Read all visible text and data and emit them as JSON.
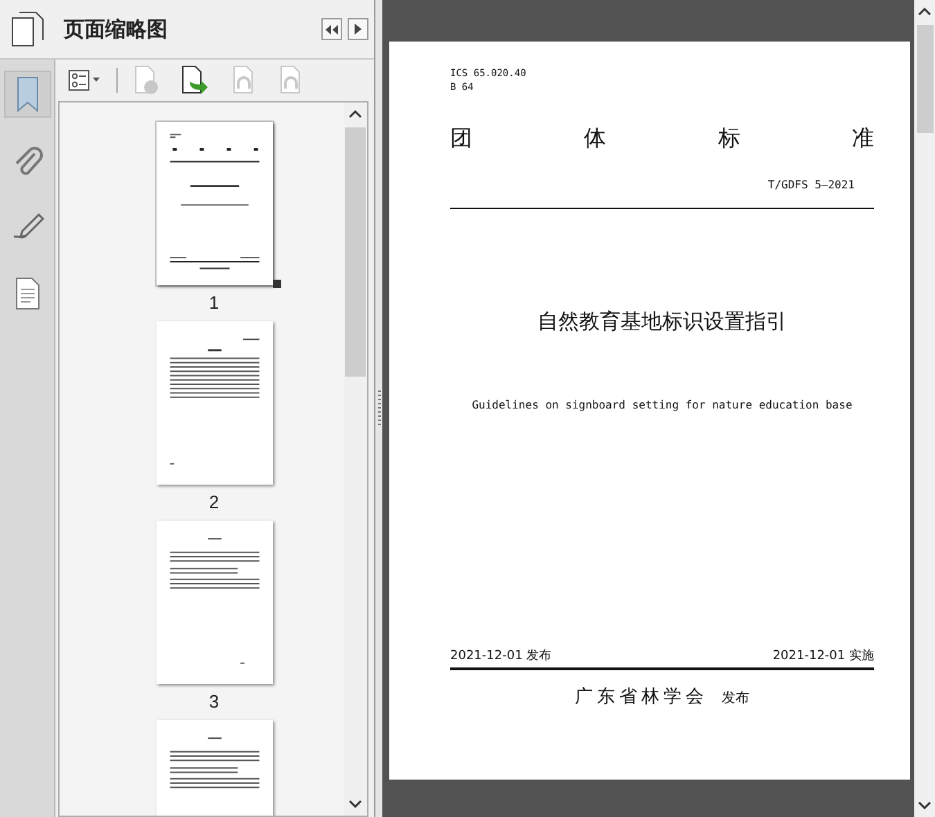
{
  "panel": {
    "title": "页面缩略图"
  },
  "side_tabs": [
    {
      "kind": "bookmark",
      "selected": true
    },
    {
      "kind": "attachment",
      "selected": false
    },
    {
      "kind": "signature",
      "selected": false
    },
    {
      "kind": "layers",
      "selected": false
    }
  ],
  "toolbar": [
    {
      "kind": "options",
      "disabled": false
    },
    {
      "kind": "delete",
      "disabled": true
    },
    {
      "kind": "insert",
      "disabled": false
    },
    {
      "kind": "undo",
      "disabled": true
    },
    {
      "kind": "redo",
      "disabled": true
    }
  ],
  "thumbnails": [
    {
      "kind": "cover",
      "label": "1",
      "selected": true
    },
    {
      "kind": "toc",
      "label": "2",
      "selected": false
    },
    {
      "kind": "text",
      "label": "3",
      "selected": false
    },
    {
      "kind": "text",
      "selected": false
    }
  ],
  "document": {
    "codes": [
      "ICS 65.020.40",
      "B 64"
    ],
    "heading": "团 体 标 准",
    "number": "T/GDFS 5—2021",
    "title": "自然教育基地标识设置指引",
    "subtitle": "Guidelines on signboard setting for nature education base",
    "issued": "2021-12-01 发布",
    "effective": "2021-12-01 实施",
    "publisher": "广东省林学会",
    "publisher_suffix": "发布"
  }
}
